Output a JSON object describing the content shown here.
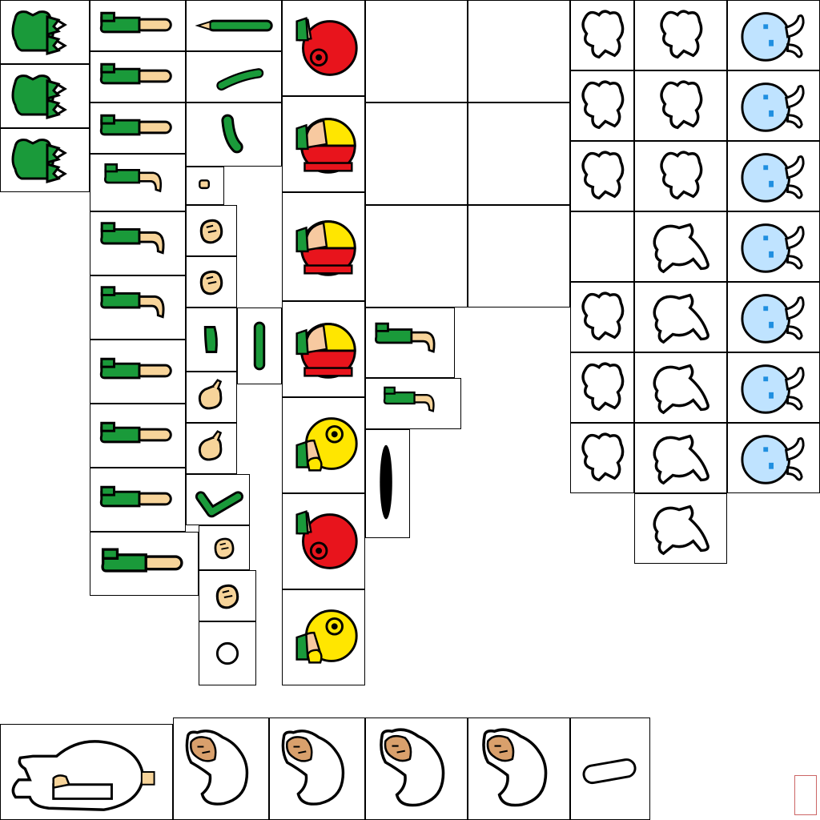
{
  "sheet": {
    "title": "",
    "stamp_text": "",
    "colors": {
      "green": "#1a9a3a",
      "skin": "#f7d49a",
      "red": "#e8141c",
      "yellow": "#ffe600",
      "light_blue": "#bfe3ff",
      "blue_eye": "#1f8fe0",
      "black": "#000000",
      "white": "#ffffff"
    }
  },
  "sprites": [
    {
      "icon": "green-vest-icon"
    },
    {
      "icon": "leg-straight-icon"
    },
    {
      "icon": "arm-thin-icon"
    },
    {
      "icon": "red-helmet-head-icon"
    },
    {
      "icon": "yellow-helmet-head-icon"
    },
    {
      "icon": "bent-leg-icon"
    },
    {
      "icon": "hand-icon"
    },
    {
      "icon": "black-ellipse-icon"
    },
    {
      "icon": "white-blob-outline-icon"
    },
    {
      "icon": "blue-ghost-icon"
    },
    {
      "icon": "white-blob-big-icon"
    },
    {
      "icon": "face-in-white-blob-icon"
    },
    {
      "icon": "white-pill-icon"
    },
    {
      "icon": "circle-outline-icon"
    }
  ]
}
